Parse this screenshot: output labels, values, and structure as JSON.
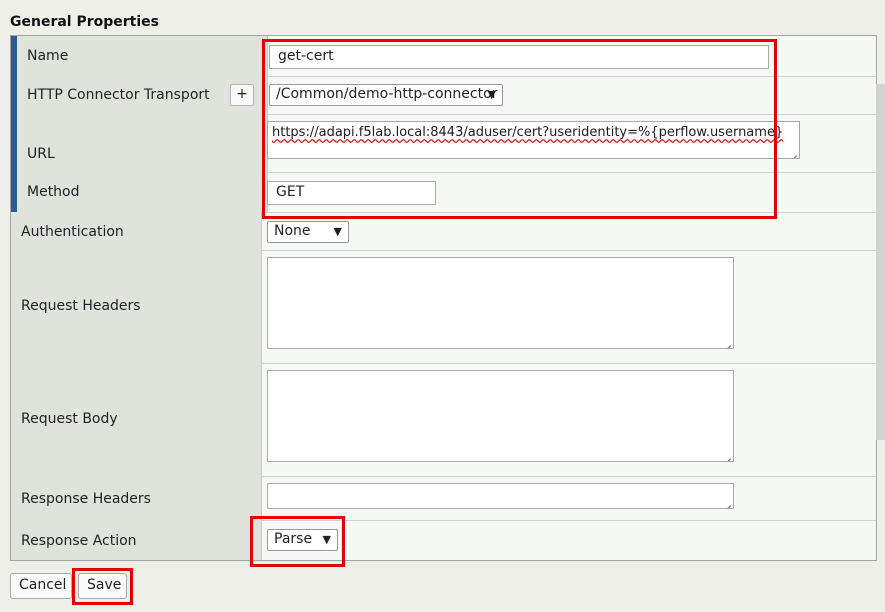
{
  "section_title": "General Properties",
  "fields": {
    "name": {
      "label": "Name",
      "value": "get-cert"
    },
    "transport": {
      "label": "HTTP Connector Transport",
      "add_label": "+",
      "selected": "/Common/demo-http-connector"
    },
    "url": {
      "label": "URL",
      "value": "https://adapi.f5lab.local:8443/aduser/cert?useridentity=%{perflow.username}"
    },
    "method": {
      "label": "Method",
      "value": "GET"
    },
    "authentication": {
      "label": "Authentication",
      "selected": "None"
    },
    "request_headers": {
      "label": "Request Headers",
      "value": ""
    },
    "request_body": {
      "label": "Request Body",
      "value": ""
    },
    "response_headers": {
      "label": "Response Headers",
      "value": ""
    },
    "response_action": {
      "label": "Response Action",
      "selected": "Parse"
    }
  },
  "buttons": {
    "cancel": "Cancel",
    "save": "Save"
  },
  "icons": {
    "dropdown": "▼"
  },
  "colors": {
    "highlight": "#e60000",
    "required_marker": "#2c5c98"
  }
}
